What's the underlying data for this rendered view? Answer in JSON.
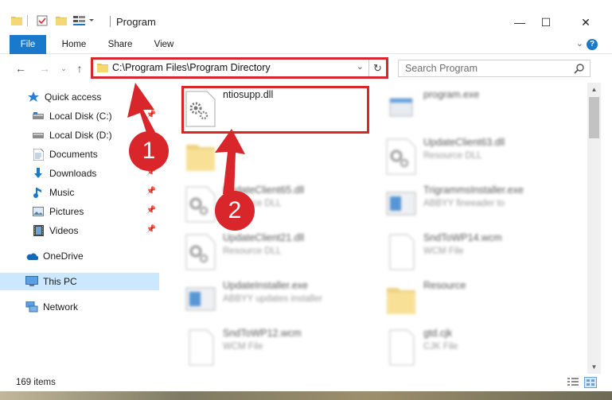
{
  "window": {
    "title": "Program",
    "minimize_label": "—",
    "maximize_label": "☐",
    "close_label": "✕"
  },
  "ribbon": {
    "tabs": [
      "File",
      "Home",
      "Share",
      "View"
    ],
    "help_label": "?"
  },
  "address": {
    "path": "C:\\Program Files\\Program Directory",
    "search_placeholder": "Search Program"
  },
  "sidebar": {
    "items": [
      {
        "label": "Quick access",
        "icon": "star-icon",
        "pinned": false
      },
      {
        "label": "Local Disk (C:)",
        "icon": "drive-icon",
        "pinned": true
      },
      {
        "label": "Local Disk (D:)",
        "icon": "drive-icon",
        "pinned": false
      },
      {
        "label": "Documents",
        "icon": "documents-icon",
        "pinned": true
      },
      {
        "label": "Downloads",
        "icon": "download-icon",
        "pinned": true
      },
      {
        "label": "Music",
        "icon": "music-icon",
        "pinned": true
      },
      {
        "label": "Pictures",
        "icon": "pictures-icon",
        "pinned": true
      },
      {
        "label": "Videos",
        "icon": "videos-icon",
        "pinned": true
      },
      {
        "label": "OneDrive",
        "icon": "cloud-icon",
        "pinned": false
      },
      {
        "label": "This PC",
        "icon": "computer-icon",
        "pinned": false,
        "selected": true
      },
      {
        "label": "Network",
        "icon": "network-icon",
        "pinned": false
      }
    ]
  },
  "files": [
    {
      "name": "ntiosupp.dll",
      "desc": "",
      "icon": "dll-gear-icon",
      "highlighted": true
    },
    {
      "name": "program.exe",
      "desc": "",
      "icon": "exe-icon"
    },
    {
      "name": "",
      "desc": "",
      "icon": "folder-icon"
    },
    {
      "name": "UpdateClient63.dll",
      "desc": "Resource DLL",
      "icon": "dll-gear-icon"
    },
    {
      "name": "UpdateClient65.dll",
      "desc": "Resource DLL",
      "icon": "dll-gear-icon"
    },
    {
      "name": "TrigrammsInstaller.exe",
      "desc": "ABBYY fineeader to",
      "icon": "installer-icon"
    },
    {
      "name": "UpdateClient21.dll",
      "desc": "Resource DLL",
      "icon": "dll-gear-icon"
    },
    {
      "name": "SndToWP14.wcm",
      "desc": "WCM File",
      "icon": "blank-file-icon"
    },
    {
      "name": "UpdateInstaller.exe",
      "desc": "ABBYY updates installer",
      "icon": "installer-icon"
    },
    {
      "name": "Resource",
      "desc": "",
      "icon": "folder-icon"
    },
    {
      "name": "SndToWP12.wcm",
      "desc": "WCM File",
      "icon": "blank-file-icon"
    },
    {
      "name": "gtd.cjk",
      "desc": "CJK File",
      "icon": "blank-file-icon"
    }
  ],
  "status": {
    "item_count": "169 items"
  },
  "annotations": {
    "step1": "1",
    "step2": "2",
    "color": "#d9262b"
  }
}
